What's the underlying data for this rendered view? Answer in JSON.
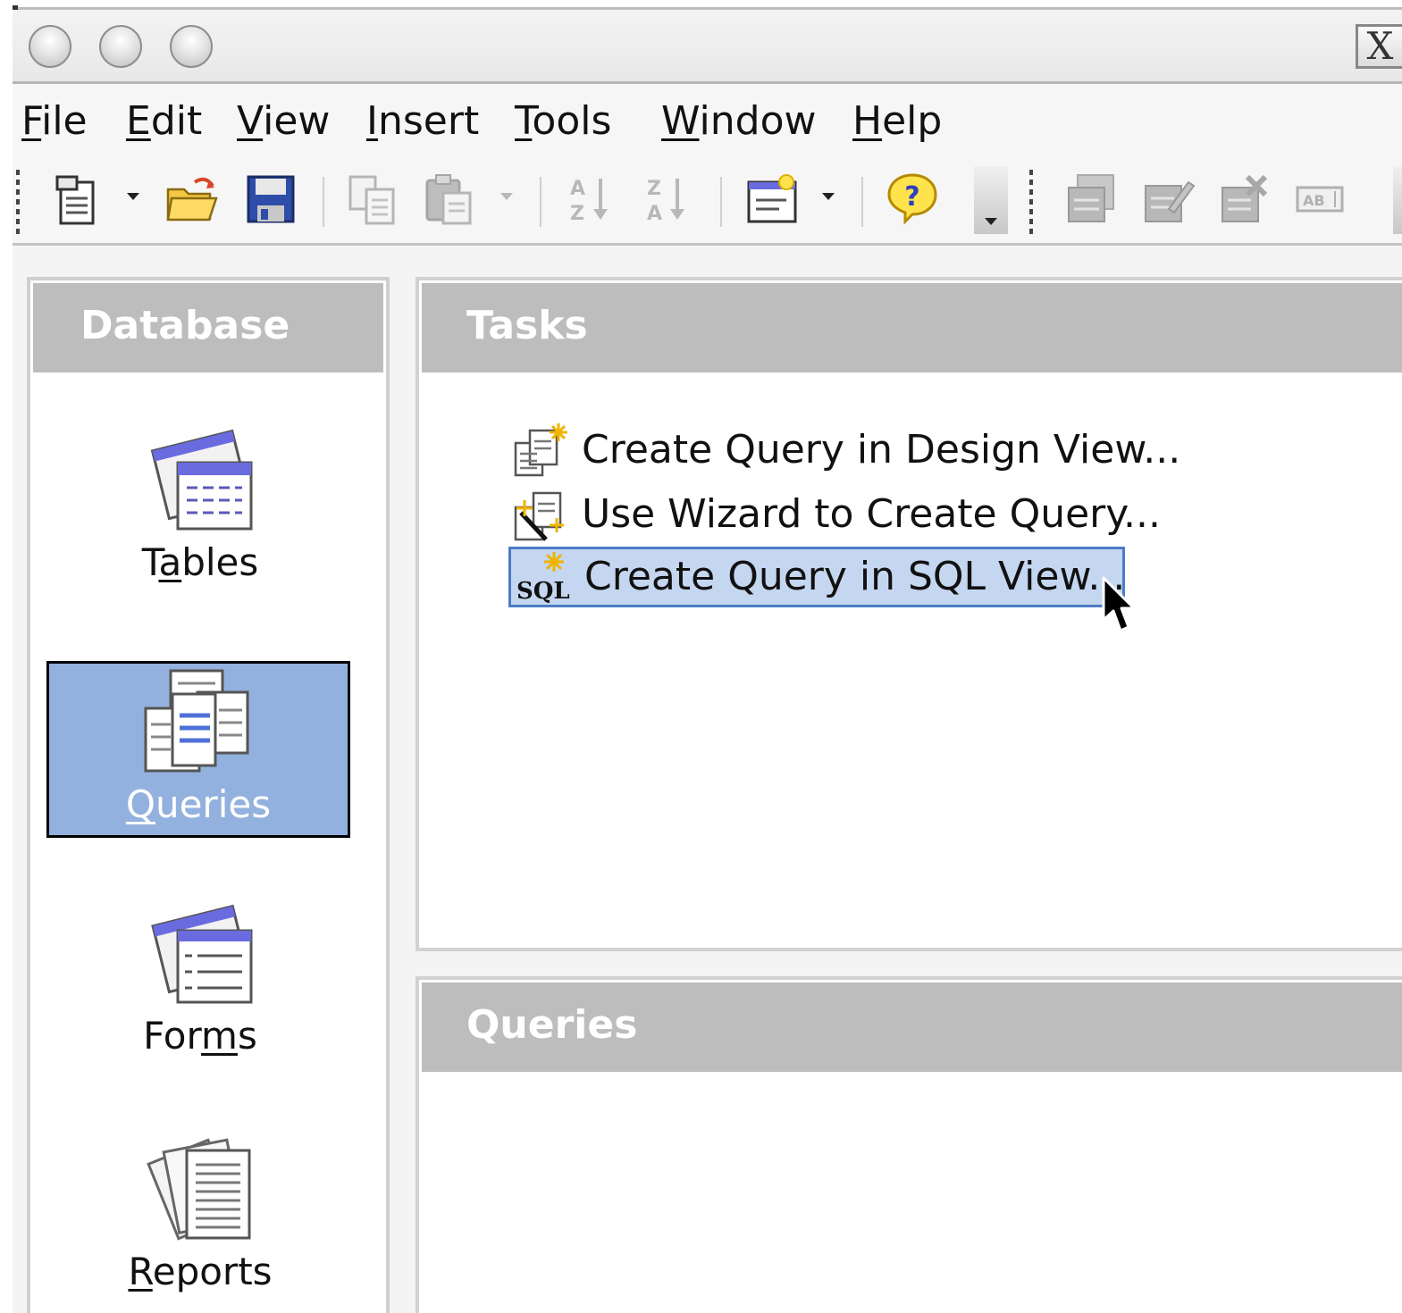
{
  "window": {
    "close_glyph": "X"
  },
  "menu": {
    "items": [
      {
        "first": "F",
        "rest": "ile"
      },
      {
        "first": "E",
        "rest": "dit"
      },
      {
        "first": "V",
        "rest": "iew"
      },
      {
        "first": "I",
        "rest": "nsert"
      },
      {
        "first": "T",
        "rest": "ools"
      },
      {
        "first": "W",
        "rest": "indow"
      },
      {
        "first": "H",
        "rest": "elp"
      }
    ]
  },
  "toolbar": {
    "icons": [
      "new-document-icon",
      "open-folder-icon",
      "save-icon",
      "copy-icon",
      "paste-icon",
      "sort-ascending-icon",
      "sort-descending-icon",
      "form-design-icon",
      "help-icon",
      "form-icon",
      "edit-form-icon",
      "delete-form-icon",
      "text-field-icon"
    ]
  },
  "sidebar": {
    "header": "Database",
    "items": [
      {
        "pre": "T",
        "ul": "a",
        "post": "bles",
        "icon": "tables-icon",
        "selected": false
      },
      {
        "pre": "",
        "ul": "Q",
        "post": "ueries",
        "icon": "queries-icon",
        "selected": true
      },
      {
        "pre": "For",
        "ul": "m",
        "post": "s",
        "icon": "forms-icon",
        "selected": false
      },
      {
        "pre": "",
        "ul": "R",
        "post": "eports",
        "icon": "reports-icon",
        "selected": false
      }
    ]
  },
  "tasks": {
    "header": "Tasks",
    "items": [
      {
        "label": "Create Query in Design View...",
        "icon": "design-view-icon"
      },
      {
        "label": "Use Wizard to Create Query...",
        "icon": "wizard-icon"
      },
      {
        "label": "Create Query in SQL View...",
        "icon": "sql-view-icon"
      }
    ]
  },
  "queries": {
    "header": "Queries"
  },
  "colors": {
    "selection": "#93b1de",
    "task_highlight": "#c5d6f0",
    "task_highlight_border": "#4c7cc4",
    "header_gray": "#bdbdbd",
    "accent_purple": "#6b6be0"
  }
}
